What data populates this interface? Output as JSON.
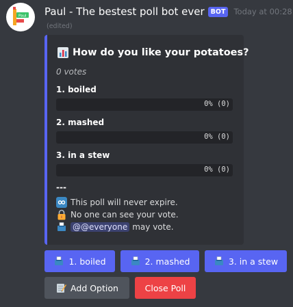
{
  "message": {
    "author": "Paul - The bestest poll bot ever",
    "bot_tag": "BOT",
    "timestamp": "Today at 00:28",
    "edited": "(edited)",
    "avatar_text": "Paul"
  },
  "poll": {
    "title": "How do you like your potatoes?",
    "votes": "0 votes",
    "options": [
      {
        "label": "1. boiled",
        "result": "0% (0)",
        "fraction": 0
      },
      {
        "label": "2. mashed",
        "result": "0% (0)",
        "fraction": 0
      },
      {
        "label": "3. in a stew",
        "result": "0% (0)",
        "fraction": 0
      }
    ],
    "divider": "---",
    "expiry": "This poll will never expire.",
    "visibility": "No one can see your vote.",
    "mention": "@@everyone",
    "may_vote": "may vote."
  },
  "buttons": {
    "vote": [
      "1. boiled",
      "2. mashed",
      "3. in a stew"
    ],
    "add_option": "Add Option",
    "close_poll": "Close Poll"
  },
  "colors": {
    "accent": "#5865f2",
    "danger": "#ed4245",
    "secondary": "#4f545c",
    "background": "#36393f",
    "embed": "#2f3136"
  },
  "icons": {
    "title": "bar-chart-icon",
    "expiry": "infinity-icon",
    "visibility": "lock-icon",
    "mention": "ballot-box-icon",
    "vote_button": "ballot-box-icon",
    "add_option": "memo-icon"
  }
}
